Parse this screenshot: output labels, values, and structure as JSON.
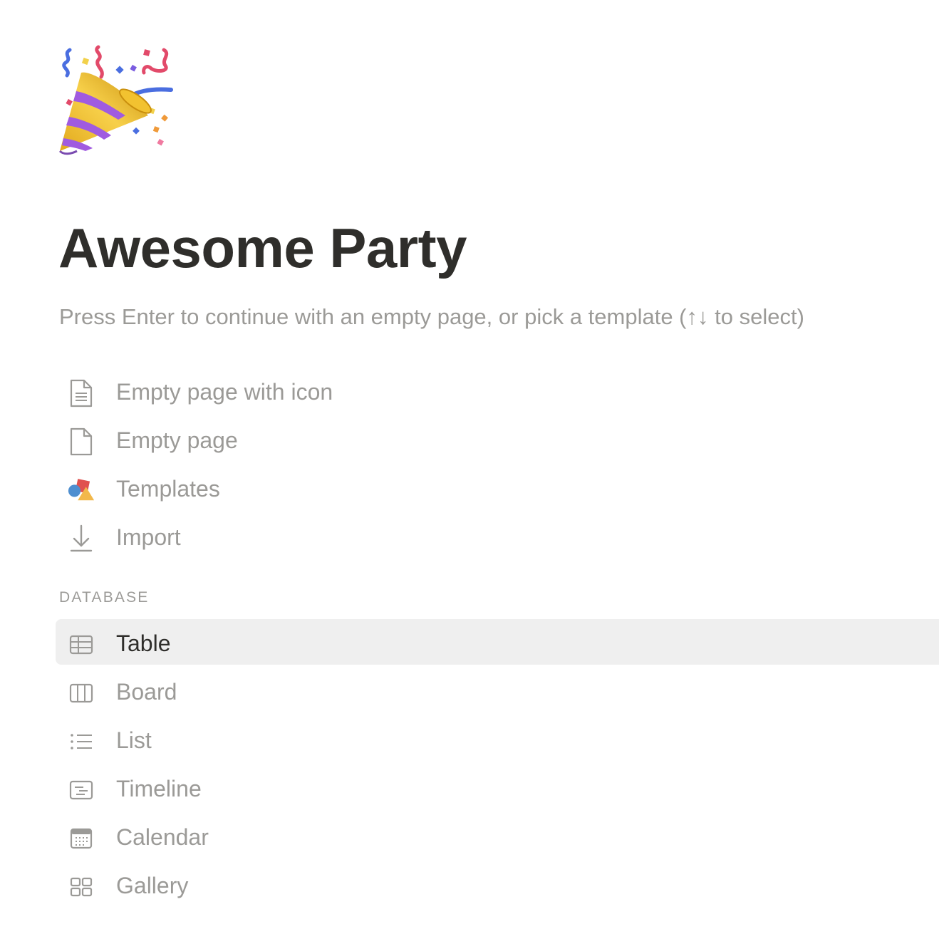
{
  "page": {
    "icon": "party-popper-icon",
    "title": "Awesome Party",
    "hint": "Press Enter to continue with an empty page, or pick a template (↑↓ to select)"
  },
  "options": [
    {
      "label": "Empty page with icon",
      "icon": "page-with-lines-icon"
    },
    {
      "label": "Empty page",
      "icon": "blank-page-icon"
    },
    {
      "label": "Templates",
      "icon": "shapes-icon"
    },
    {
      "label": "Import",
      "icon": "download-arrow-icon"
    }
  ],
  "database": {
    "section_label": "DATABASE",
    "selected": "Table",
    "items": [
      {
        "label": "Table",
        "icon": "table-icon"
      },
      {
        "label": "Board",
        "icon": "board-columns-icon"
      },
      {
        "label": "List",
        "icon": "list-icon"
      },
      {
        "label": "Timeline",
        "icon": "timeline-icon"
      },
      {
        "label": "Calendar",
        "icon": "calendar-icon"
      },
      {
        "label": "Gallery",
        "icon": "gallery-grid-icon"
      }
    ]
  },
  "colors": {
    "selected_background": "#efefef",
    "muted_text": "#9b9a97",
    "primary_text": "#2f2e2b"
  }
}
